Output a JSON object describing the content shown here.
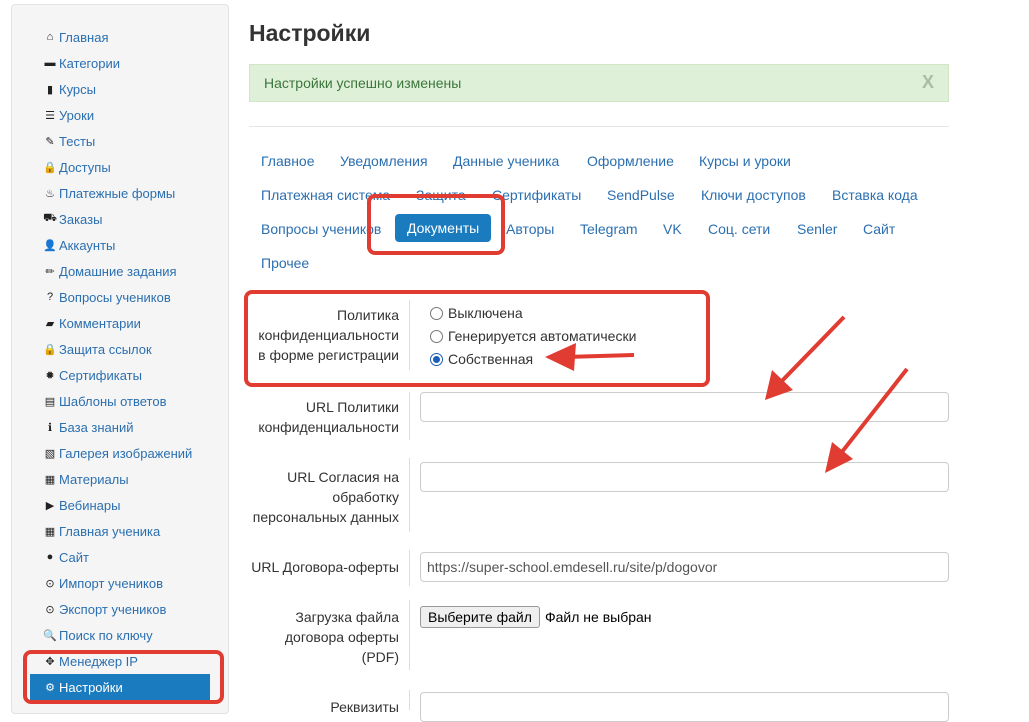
{
  "sidebar": {
    "items": [
      {
        "label": "Главная",
        "icon": "⌂"
      },
      {
        "label": "Категории",
        "icon": "▬"
      },
      {
        "label": "Курсы",
        "icon": "▮"
      },
      {
        "label": "Уроки",
        "icon": "☰"
      },
      {
        "label": "Тесты",
        "icon": "✎"
      },
      {
        "label": "Доступы",
        "icon": "🔒"
      },
      {
        "label": "Платежные формы",
        "icon": "♨"
      },
      {
        "label": "Заказы",
        "icon": "⛟"
      },
      {
        "label": "Аккаунты",
        "icon": "👤"
      },
      {
        "label": "Домашние задания",
        "icon": "✏"
      },
      {
        "label": "Вопросы учеников",
        "icon": "?"
      },
      {
        "label": "Комментарии",
        "icon": "▰"
      },
      {
        "label": "Защита ссылок",
        "icon": "🔒"
      },
      {
        "label": "Сертификаты",
        "icon": "✹"
      },
      {
        "label": "Шаблоны ответов",
        "icon": "▤"
      },
      {
        "label": "База знаний",
        "icon": "ℹ"
      },
      {
        "label": "Галерея изображений",
        "icon": "▧"
      },
      {
        "label": "Материалы",
        "icon": "▦"
      },
      {
        "label": "Вебинары",
        "icon": "▶"
      },
      {
        "label": "Главная ученика",
        "icon": "▦"
      },
      {
        "label": "Сайт",
        "icon": "●"
      },
      {
        "label": "Импорт учеников",
        "icon": "⊙"
      },
      {
        "label": "Экспорт учеников",
        "icon": "⊙"
      },
      {
        "label": "Поиск по ключу",
        "icon": "🔍"
      },
      {
        "label": "Менеджер IP",
        "icon": "✥"
      },
      {
        "label": "Настройки",
        "icon": "⚙"
      }
    ]
  },
  "page": {
    "title": "Настройки",
    "alert": "Настройки успешно изменены",
    "alert_close": "X"
  },
  "tabs": [
    "Главное",
    "Уведомления",
    "Данные ученика",
    "Оформление",
    "Курсы и уроки",
    "Платежная система",
    "Защита",
    "Сертификаты",
    "SendPulse",
    "Ключи доступов",
    "Вставка кода",
    "Вопросы учеников",
    "Документы",
    "Авторы",
    "Telegram",
    "VK",
    "Соц. сети",
    "Senler",
    "Сайт",
    "Прочее"
  ],
  "form": {
    "policy_label_1": "Политика",
    "policy_label_2": "конфиденциальности",
    "policy_label_3": "в форме регистрации",
    "radio_off": "Выключена",
    "radio_auto": "Генерируется автоматически",
    "radio_own": "Собственная",
    "url_policy_label_1": "URL Политики",
    "url_policy_label_2": "конфиденциальности",
    "url_policy_value": "",
    "url_consent_label_1": "URL Согласия на",
    "url_consent_label_2": "обработку",
    "url_consent_label_3": "персональных данных",
    "url_consent_value": "",
    "url_offer_label": "URL Договора-оферты",
    "url_offer_value": "https://super-school.emdesell.ru/site/p/dogovor",
    "upload_label_1": "Загрузка файла",
    "upload_label_2": "договора оферты",
    "upload_label_3": "(PDF)",
    "upload_button": "Выберите файл",
    "upload_status": "Файл не выбран",
    "requisites_label": "Реквизиты"
  },
  "colors": {
    "accent": "#1a7bbf",
    "link": "#2b6fb0",
    "annotation": "#e03c31",
    "alert_bg": "#dff0d8"
  }
}
